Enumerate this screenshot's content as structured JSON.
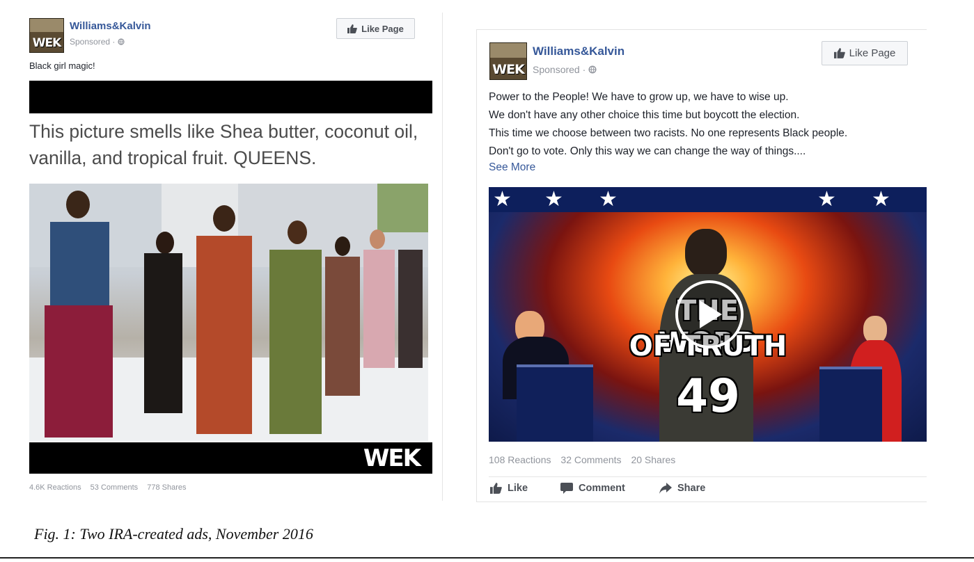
{
  "post_left": {
    "page_name": "Williams&Kalvin",
    "sponsored": "Sponsored · ",
    "like_page": "Like Page",
    "text": "Black girl magic!",
    "caption": "This picture smells like Shea butter, coconut oil, vanilla, and tropical fruit. QUEENS.",
    "watermark": "WEK",
    "stats": {
      "reactions": "4.6K Reactions",
      "comments": "53 Comments",
      "shares": "778 Shares"
    }
  },
  "post_right": {
    "page_name": "Williams&Kalvin",
    "sponsored": "Sponsored · ",
    "like_page": "Like Page",
    "text_lines": [
      "Power to the People! We have to grow up, we have to wise up.",
      "We don't have any other choice this time but boycott the election.",
      "This time we choose between two racists. No one represents Black people.",
      "Don't go to vote. Only this way we can change the way of things...."
    ],
    "see_more": "See More",
    "video": {
      "title_line1": "THE WORD",
      "title_line2": "OF TRUTH",
      "number": "49"
    },
    "stats": {
      "reactions": "108 Reactions",
      "comments": "32 Comments",
      "shares": "20 Shares"
    },
    "actions": {
      "like": "Like",
      "comment": "Comment",
      "share": "Share"
    }
  },
  "avatar_logo": "WEK",
  "figure_caption": "Fig. 1: Two IRA-created ads, November 2016",
  "colors": {
    "link_blue": "#365899",
    "meta_gray": "#90949c"
  },
  "icons": [
    "thumbs-up-icon",
    "globe-icon",
    "play-icon",
    "comment-icon",
    "share-arrow-icon"
  ]
}
